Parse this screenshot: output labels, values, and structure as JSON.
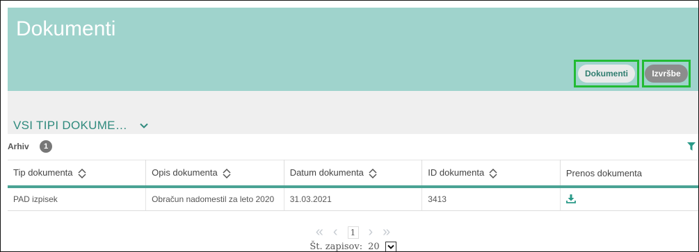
{
  "header": {
    "title": "Dokumenti",
    "buttons": [
      {
        "label": "Dokumenti"
      },
      {
        "label": "Izvršbe"
      }
    ]
  },
  "filter": {
    "label": "VSI TIPI DOKUME…",
    "icon": "chevron-down-icon"
  },
  "archive": {
    "label": "Arhiv",
    "count": "1"
  },
  "table": {
    "columns": [
      "Tip dokumenta",
      "Opis dokumenta",
      "Datum dokumenta",
      "ID dokumenta",
      "Prenos dokumenta"
    ],
    "rows": [
      {
        "tip": "PAD izpisek",
        "opis": "Obračun nadomestil za leto 2020",
        "datum": "31.03.2021",
        "id": "3413",
        "download": "download-icon"
      }
    ]
  },
  "pagination": {
    "first": "«",
    "prev": "‹",
    "page": "1",
    "next": "›",
    "last": "»",
    "records_label": "Št. zapisov:",
    "records_value": "20"
  },
  "colors": {
    "header_bg": "#9fd3cc",
    "accent": "#4aa394",
    "highlight_border": "#22bb33",
    "filter_text": "#2f8a7d"
  }
}
